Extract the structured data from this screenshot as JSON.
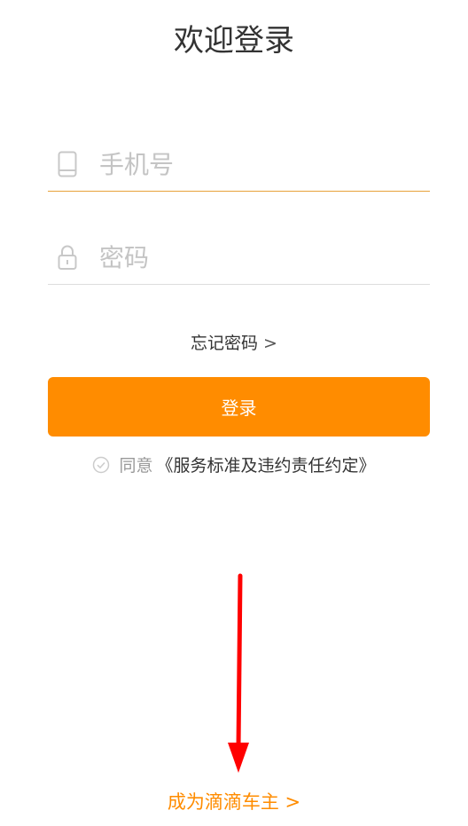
{
  "header": {
    "title": "欢迎登录"
  },
  "form": {
    "phone_placeholder": "手机号",
    "password_placeholder": "密码",
    "forgot_password_label": "忘记密码",
    "forgot_chevron": ">",
    "login_button_label": "登录"
  },
  "agreement": {
    "prefix": "同意",
    "link_text": "《服务标准及违约责任约定》",
    "checked": false
  },
  "footer": {
    "become_driver_label": "成为滴滴车主 >"
  },
  "icons": {
    "phone": "phone-icon",
    "lock": "lock-icon",
    "check": "check-circle-icon",
    "annotation_arrow": "arrow-down-icon"
  },
  "colors": {
    "accent": "#ff8c00",
    "active_underline": "#e8a23a",
    "placeholder": "#c4c4c4",
    "annotation_arrow": "#ff0000"
  }
}
